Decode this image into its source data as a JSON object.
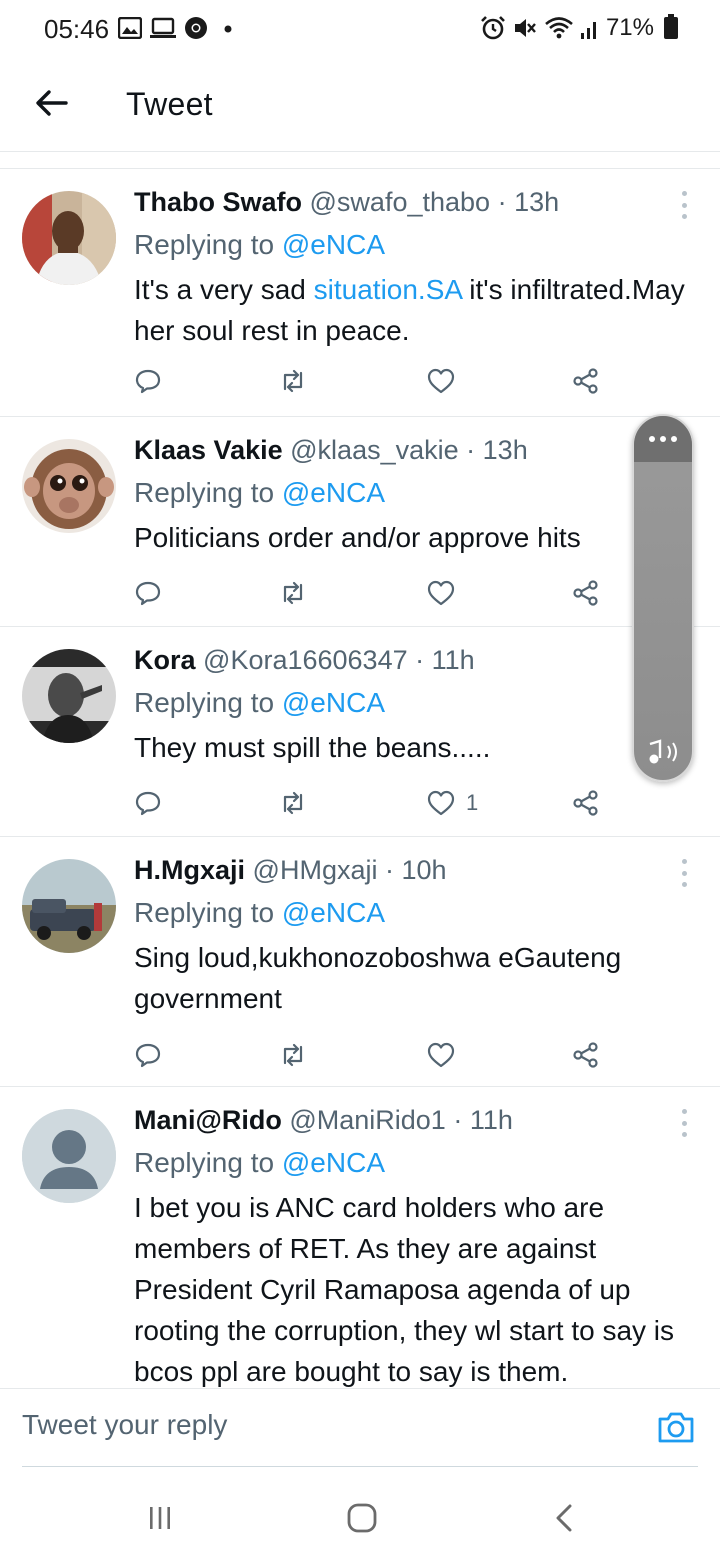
{
  "status_bar": {
    "time": "05:46",
    "battery": "71%",
    "left_icons": [
      "gallery-icon",
      "screen-icon",
      "chrome-icon",
      "dot-icon"
    ],
    "right_icons": [
      "alarm-icon",
      "mute-icon",
      "wifi-icon",
      "signal-icon",
      "battery-icon"
    ]
  },
  "header": {
    "title": "Tweet"
  },
  "tweets": [
    {
      "name": "Thabo Swafo",
      "handle": "@swafo_thabo",
      "time": "13h",
      "replying_prefix": "Replying to ",
      "replying_to": "@eNCA",
      "text_parts": [
        "It's a very sad ",
        "situation.SA",
        " it's infiltrated.May her soul rest in peace."
      ],
      "likes": ""
    },
    {
      "name": "Klaas Vakie",
      "handle": "@klaas_vakie",
      "time": "13h",
      "replying_prefix": "Replying to ",
      "replying_to": "@eNCA",
      "text": "Politicians order and/or approve hits",
      "likes": ""
    },
    {
      "name": "Kora",
      "handle": "@Kora16606347",
      "time": "11h",
      "replying_prefix": "Replying to ",
      "replying_to": "@eNCA",
      "text": "They must spill the beans.....",
      "likes": "1"
    },
    {
      "name": "H.Mgxaji",
      "handle": "@HMgxaji",
      "time": "10h",
      "replying_prefix": "Replying to ",
      "replying_to": "@eNCA",
      "text": "Sing loud,kukhonozoboshwa eGauteng government",
      "likes": ""
    },
    {
      "name": "Mani@Rido",
      "handle": "@ManiRido1",
      "time": "11h",
      "replying_prefix": "Replying to ",
      "replying_to": "@eNCA",
      "text": "I bet you is ANC card holders who are members of RET. As they are against President Cyril Ramaposa agenda of up rooting the corruption, they wl start to say is bcos ppl are bought to say is them.",
      "likes": ""
    }
  ],
  "reply_bar": {
    "placeholder": "Tweet your reply"
  },
  "colors": {
    "accent": "#1d9bf0",
    "secondary_text": "#536471",
    "divider": "#e6e9eb"
  }
}
